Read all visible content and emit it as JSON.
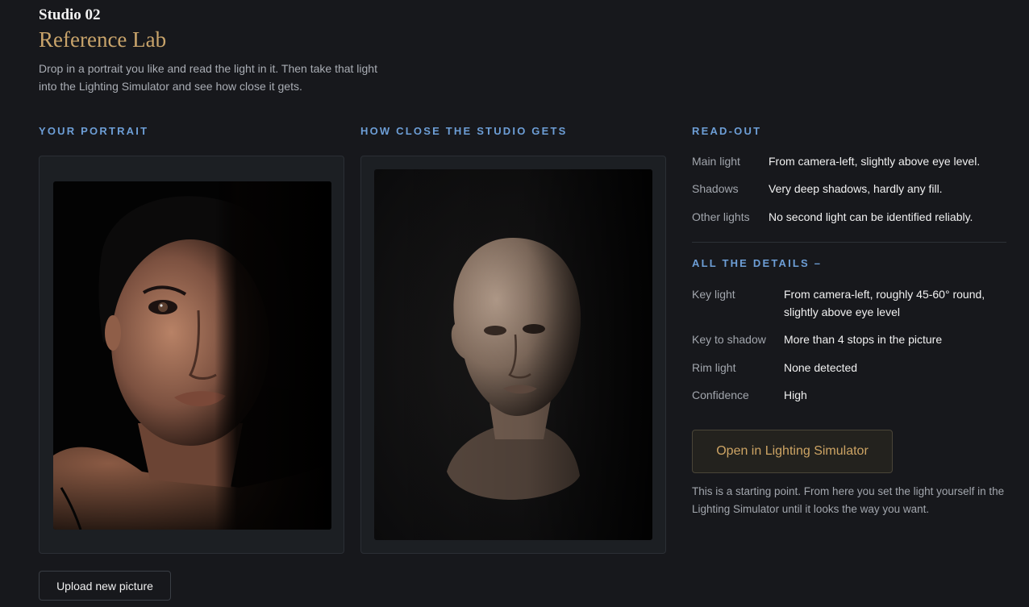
{
  "header": {
    "eyebrow": "Studio 02",
    "title": "Reference Lab",
    "intro": "Drop in a portrait you like and read the light in it. Then take that light into the Lighting Simulator and see how close it gets."
  },
  "sections": {
    "portrait_label": "YOUR PORTRAIT",
    "studio_label": "HOW CLOSE THE STUDIO GETS",
    "readout_label": "READ-OUT",
    "details_label": "ALL THE DETAILS –"
  },
  "readout": [
    {
      "key": "Main light",
      "value": "From camera-left, slightly above eye level."
    },
    {
      "key": "Shadows",
      "value": "Very deep shadows, hardly any fill."
    },
    {
      "key": "Other lights",
      "value": "No second light can be identified reliably."
    }
  ],
  "details": [
    {
      "key": "Key light",
      "value": "From camera-left, roughly 45-60° round, slightly above eye level"
    },
    {
      "key": "Key to shadow",
      "value": "More than 4 stops in the picture"
    },
    {
      "key": "Rim light",
      "value": "None detected"
    },
    {
      "key": "Confidence",
      "value": "High"
    }
  ],
  "actions": {
    "upload_label": "Upload new picture",
    "open_label": "Open in Lighting Simulator"
  },
  "footnote": "This is a starting point. From here you set the light yourself in the Lighting Simulator until it looks the way you want.",
  "colors": {
    "accent_gold": "#c9a46b",
    "label_blue": "#6d9ed6",
    "background": "#17181c"
  }
}
